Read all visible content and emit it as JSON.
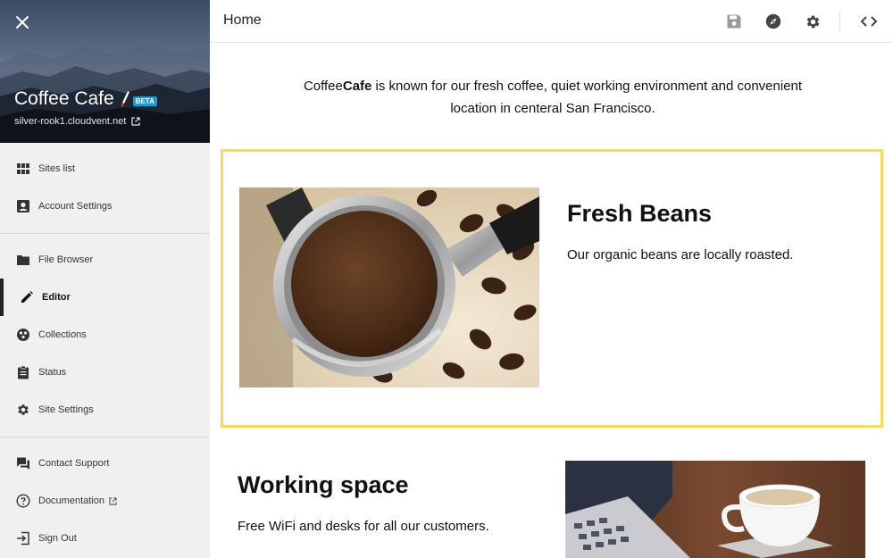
{
  "site": {
    "title": "Coffee Cafe",
    "beta": "BETA",
    "url": "silver-rook1.cloudvent.net"
  },
  "nav": {
    "group1": [
      {
        "label": "Sites list",
        "icon": "grid-icon"
      },
      {
        "label": "Account Settings",
        "icon": "account-box-icon"
      }
    ],
    "group2": [
      {
        "label": "File Browser",
        "icon": "folder-icon"
      },
      {
        "label": "Editor",
        "icon": "pencil-icon",
        "active": true
      },
      {
        "label": "Collections",
        "icon": "collections-icon"
      },
      {
        "label": "Status",
        "icon": "clipboard-icon"
      },
      {
        "label": "Site Settings",
        "icon": "gear-icon"
      }
    ],
    "group3": [
      {
        "label": "Contact Support",
        "icon": "chat-icon"
      },
      {
        "label": "Documentation",
        "icon": "help-circle-icon"
      },
      {
        "label": "Sign Out",
        "icon": "sign-out-icon"
      }
    ]
  },
  "topbar": {
    "title": "Home",
    "icons": [
      "save-icon",
      "compass-icon",
      "gear-icon",
      "code-icon"
    ]
  },
  "content": {
    "intro_prefix": "Coffee",
    "intro_brand": "Cafe",
    "intro_rest": " is known for our fresh coffee, quiet working environment and convenient location in centeral San Francisco.",
    "fresh": {
      "title": "Fresh Beans",
      "desc": "Our organic beans are locally roasted."
    },
    "work": {
      "title": "Working space",
      "desc": "Free WiFi and desks for all our customers."
    }
  },
  "colors": {
    "highlight_border": "#f5dd5b",
    "beta_badge": "#1d9bd1",
    "active_marker": "#222222"
  }
}
